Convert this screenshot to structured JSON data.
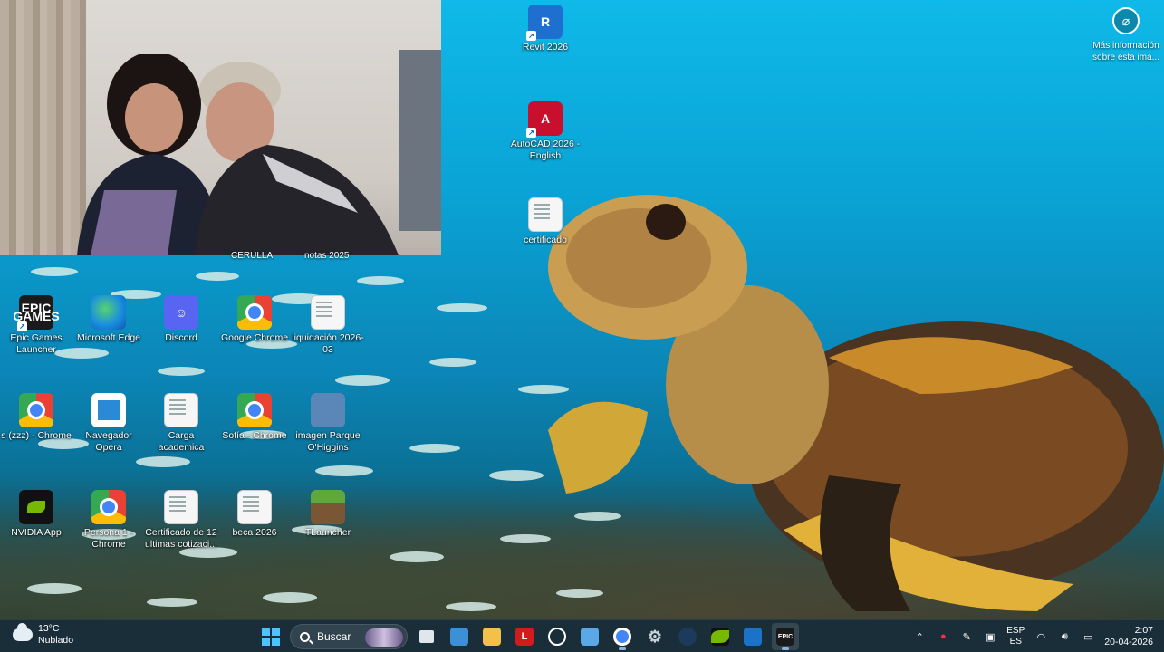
{
  "desktop": {
    "icons": [
      {
        "name": "epic-games-launcher-icon",
        "label": "Epic Games Launcher",
        "glyph": "EPIC GAMES"
      },
      {
        "name": "microsoft-edge-icon",
        "label": "Microsoft Edge",
        "glyph": ""
      },
      {
        "name": "discord-icon",
        "label": "Discord",
        "glyph": "☺"
      },
      {
        "name": "google-chrome-icon",
        "label": "Google Chrome",
        "glyph": ""
      },
      {
        "name": "liquidacion-doc-icon",
        "label": "liquidación 2026-03",
        "glyph": ""
      },
      {
        "name": "chrome-profile-zzz-icon",
        "label": "s (zzz) - Chrome",
        "glyph": ""
      },
      {
        "name": "navegador-opera-icon",
        "label": "Navegador Opera",
        "glyph": ""
      },
      {
        "name": "carga-academica-doc-icon",
        "label": "Carga academica",
        "glyph": ""
      },
      {
        "name": "sofia-chrome-icon",
        "label": "Sofía - Chrome",
        "glyph": ""
      },
      {
        "name": "imagen-parque-icon",
        "label": "imagen Parque O'Higgins",
        "glyph": ""
      },
      {
        "name": "nvidia-app-icon",
        "label": "NVIDIA App",
        "glyph": ""
      },
      {
        "name": "persona-1-chrome-icon",
        "label": "Persona 1 - Chrome",
        "glyph": ""
      },
      {
        "name": "certificado-12-doc-icon",
        "label": "Certificado de 12 ultimas cotizaci...",
        "glyph": ""
      },
      {
        "name": "beca-2026-doc-icon",
        "label": "beca 2026",
        "glyph": ""
      },
      {
        "name": "tlauncher-icon",
        "label": "TLauncher",
        "glyph": ""
      },
      {
        "name": "revit-icon",
        "label": "Revit 2026",
        "glyph": "R"
      },
      {
        "name": "autocad-icon",
        "label": "AutoCAD 2026 - English",
        "glyph": "A"
      },
      {
        "name": "certificado-doc-icon",
        "label": "certificado",
        "glyph": ""
      }
    ],
    "partial_labels": [
      "CERULLA",
      "notas 2025"
    ]
  },
  "wallpaper_info": {
    "label": "Más información sobre esta ima..."
  },
  "taskbar": {
    "weather": {
      "temp": "13°C",
      "condition": "Nublado"
    },
    "search_placeholder": "Buscar",
    "apps": [
      "start",
      "search",
      "task-view",
      "files-blue",
      "file-explorer",
      "red-L",
      "media-player",
      "remote-desktop",
      "chrome",
      "settings",
      "steam",
      "nvidia",
      "outlook",
      "epic-games"
    ],
    "red_app_letter": "L",
    "epic_letter": "EPIC",
    "language": {
      "lang": "ESP",
      "layout": "ES"
    },
    "clock": {
      "time": "2:07",
      "date": "20-04-2026"
    }
  },
  "colors": {
    "taskbar_bg": "#1c2a34",
    "accent": "#4cc2ff",
    "wallpaper_top": "#0fb9e8"
  }
}
